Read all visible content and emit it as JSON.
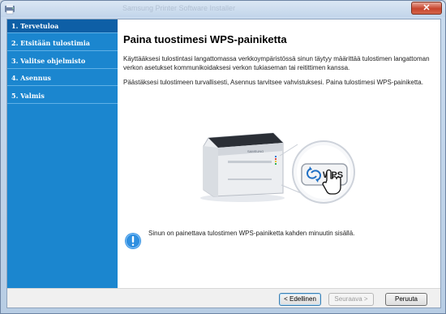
{
  "window": {
    "title": "Samsung Printer Software Installer"
  },
  "sidebar": {
    "items": [
      {
        "label": "1. Tervetuloa"
      },
      {
        "label": "2. Etsitään tulostimia"
      },
      {
        "label": "3. Valitse ohjelmisto"
      },
      {
        "label": "4. Asennus"
      },
      {
        "label": "5. Valmis"
      }
    ]
  },
  "main": {
    "title": "Paina  tuostimesi WPS-painiketta",
    "paragraph1": "Käyttääksesi tulostintasi langattomassa verkkoympäristössä sinun täytyy määrittää tulostimen langattoman verkon asetukset kommunikoidaksesi verkon tukiaseman tai reitittimen kanssa.",
    "paragraph2": "Päästäksesi tulostimeen turvallisesti, Asennus tarvitsee vahvistuksesi. Paina tulostimesi WPS-painiketta.",
    "wps_label": "WPS",
    "printer_brand": "SAMSUNG",
    "notice": "Sinun on painettava tulostimen WPS-painiketta kahden minuutin sisällä."
  },
  "footer": {
    "back_label": "< Edellinen",
    "next_label": "Seuraava >",
    "cancel_label": "Peruuta"
  },
  "colors": {
    "sidebar": "#1b86cf",
    "sidebar_active": "#0e5fa6",
    "notice_icon": "#2f8fe0"
  }
}
